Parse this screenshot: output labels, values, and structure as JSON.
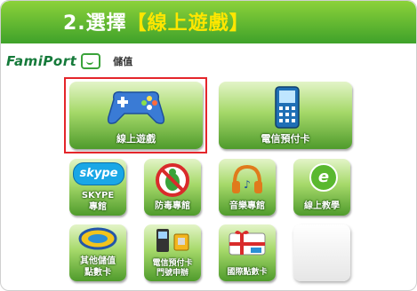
{
  "header": {
    "step": "2.選擇",
    "highlight": "【線上遊戲】"
  },
  "brand": {
    "name": "FamiPort",
    "sub": "儲值"
  },
  "tiles": {
    "online_game": "線上遊戲",
    "telecom_prepaid": "電信預付卡",
    "skype_line1": "SKYPE",
    "skype_line2": "專館",
    "antivirus": "防毒專館",
    "music": "音樂專館",
    "elearning": "線上教學",
    "other_line1": "其他儲值",
    "other_line2": "點數卡",
    "telecom_line1": "電信預付卡",
    "telecom_line2": "門號申辦",
    "intl_card": "國際點數卡"
  },
  "icons": {
    "skype_logo": "skype",
    "elearning_logo": "e"
  },
  "colors": {
    "header": "#3fa22a",
    "tile": "#7cc347",
    "selection": "#e4262b",
    "highlight": "#ffe600"
  }
}
